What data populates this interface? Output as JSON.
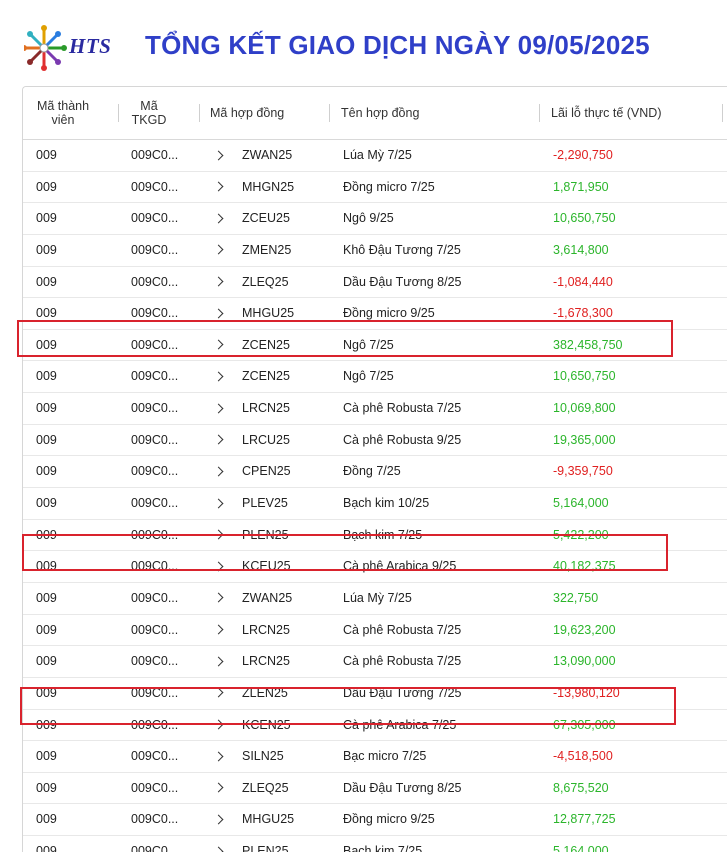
{
  "header": {
    "logo_text": "HTS",
    "title": "TỔNG KẾT GIAO DỊCH NGÀY 09/05/2025"
  },
  "table": {
    "columns": [
      "Mã thành\nviên",
      "Mã\nTKGD",
      "Mã hợp đồng",
      "Tên hợp đồng",
      "Lãi lỗ thực tế (VND)"
    ],
    "rows": [
      {
        "member": "009",
        "account": "009C0...",
        "code": "ZWAN25",
        "name": "Lúa Mỳ 7/25",
        "pl": "-2,290,750",
        "sign": "neg"
      },
      {
        "member": "009",
        "account": "009C0...",
        "code": "MHGN25",
        "name": "Đồng micro 7/25",
        "pl": "1,871,950",
        "sign": "pos"
      },
      {
        "member": "009",
        "account": "009C0...",
        "code": "ZCEU25",
        "name": "Ngô 9/25",
        "pl": "10,650,750",
        "sign": "pos"
      },
      {
        "member": "009",
        "account": "009C0...",
        "code": "ZMEN25",
        "name": "Khô Đậu Tương 7/25",
        "pl": "3,614,800",
        "sign": "pos"
      },
      {
        "member": "009",
        "account": "009C0...",
        "code": "ZLEQ25",
        "name": "Dầu Đậu Tương 8/25",
        "pl": "-1,084,440",
        "sign": "neg"
      },
      {
        "member": "009",
        "account": "009C0...",
        "code": "MHGU25",
        "name": "Đồng micro 9/25",
        "pl": "-1,678,300",
        "sign": "neg"
      },
      {
        "member": "009",
        "account": "009C0...",
        "code": "ZCEN25",
        "name": "Ngô 7/25",
        "pl": "382,458,750",
        "sign": "pos",
        "highlight": true
      },
      {
        "member": "009",
        "account": "009C0...",
        "code": "ZCEN25",
        "name": "Ngô 7/25",
        "pl": "10,650,750",
        "sign": "pos"
      },
      {
        "member": "009",
        "account": "009C0...",
        "code": "LRCN25",
        "name": "Cà phê Robusta 7/25",
        "pl": "10,069,800",
        "sign": "pos"
      },
      {
        "member": "009",
        "account": "009C0...",
        "code": "LRCU25",
        "name": "Cà phê Robusta 9/25",
        "pl": "19,365,000",
        "sign": "pos"
      },
      {
        "member": "009",
        "account": "009C0...",
        "code": "CPEN25",
        "name": "Đồng 7/25",
        "pl": "-9,359,750",
        "sign": "neg"
      },
      {
        "member": "009",
        "account": "009C0...",
        "code": "PLEV25",
        "name": "Bạch kim 10/25",
        "pl": "5,164,000",
        "sign": "pos"
      },
      {
        "member": "009",
        "account": "009C0...",
        "code": "PLEN25",
        "name": "Bạch kim 7/25",
        "pl": "5,422,200",
        "sign": "pos"
      },
      {
        "member": "009",
        "account": "009C0...",
        "code": "KCEU25",
        "name": "Cà phê Arabica 9/25",
        "pl": "40,182,375",
        "sign": "pos",
        "highlight": true
      },
      {
        "member": "009",
        "account": "009C0...",
        "code": "ZWAN25",
        "name": "Lúa Mỳ 7/25",
        "pl": "322,750",
        "sign": "pos"
      },
      {
        "member": "009",
        "account": "009C0...",
        "code": "LRCN25",
        "name": "Cà phê Robusta 7/25",
        "pl": "19,623,200",
        "sign": "pos"
      },
      {
        "member": "009",
        "account": "009C0...",
        "code": "LRCN25",
        "name": "Cà phê Robusta 7/25",
        "pl": "13,090,000",
        "sign": "pos"
      },
      {
        "member": "009",
        "account": "009C0...",
        "code": "ZLEN25",
        "name": "Dầu Đậu Tương 7/25",
        "pl": "-13,980,120",
        "sign": "neg"
      },
      {
        "member": "009",
        "account": "009C0...",
        "code": "KCEN25",
        "name": "Cà phê Arabica 7/25",
        "pl": "67,305,000",
        "sign": "pos",
        "highlight": true
      },
      {
        "member": "009",
        "account": "009C0...",
        "code": "SILN25",
        "name": "Bạc micro 7/25",
        "pl": "-4,518,500",
        "sign": "neg"
      },
      {
        "member": "009",
        "account": "009C0...",
        "code": "ZLEQ25",
        "name": "Dầu Đậu Tương 8/25",
        "pl": "8,675,520",
        "sign": "pos"
      },
      {
        "member": "009",
        "account": "009C0...",
        "code": "MHGU25",
        "name": "Đồng micro 9/25",
        "pl": "12,877,725",
        "sign": "pos"
      },
      {
        "member": "009",
        "account": "009C0...",
        "code": "PLEN25",
        "name": "Bạch kim 7/25",
        "pl": "5,164,000",
        "sign": "pos"
      }
    ]
  },
  "colors": {
    "title": "#2f3fc8",
    "positive": "#2bb52b",
    "negative": "#e02020",
    "highlight_border": "#d9232d"
  }
}
